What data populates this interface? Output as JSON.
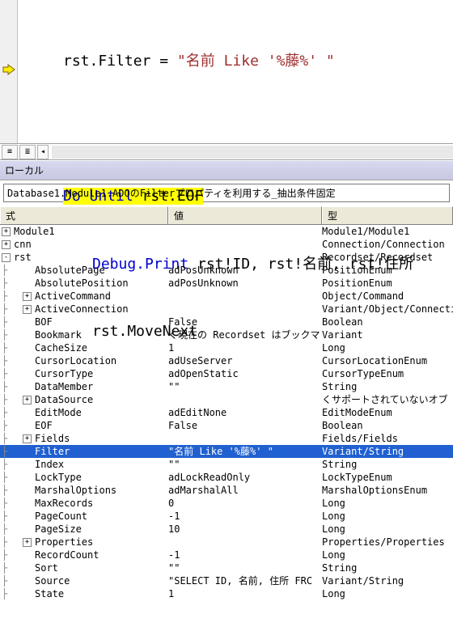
{
  "code": {
    "line1_a": "rst.Filter = ",
    "line1_b": "\"名前 Like '%藤%' \"",
    "line2_a": "Do Until",
    "line2_b": " rst.EOF",
    "line3_a": "Debug.Print",
    "line3_b": " rst!ID, rst!名前, rst!住所",
    "line4": "rst.MoveNext"
  },
  "panel_title": "ローカル",
  "context": "Database1.Module1.ADOのFilterプロパティを利用する_抽出条件固定",
  "columns": {
    "expr": "式",
    "value": "値",
    "type": "型"
  },
  "rows": [
    {
      "exp": "+",
      "depth": 0,
      "name": "Module1",
      "value": "",
      "type": "Module1/Module1"
    },
    {
      "exp": "+",
      "depth": 0,
      "name": "cnn",
      "value": "",
      "type": "Connection/Connection"
    },
    {
      "exp": "-",
      "depth": 0,
      "name": "rst",
      "value": "",
      "type": "Recordset/Recordset"
    },
    {
      "exp": "",
      "depth": 1,
      "name": "AbsolutePage",
      "value": "adPosUnknown",
      "type": "PositionEnum"
    },
    {
      "exp": "",
      "depth": 1,
      "name": "AbsolutePosition",
      "value": "adPosUnknown",
      "type": "PositionEnum"
    },
    {
      "exp": "+",
      "depth": 1,
      "name": "ActiveCommand",
      "value": "",
      "type": "Object/Command"
    },
    {
      "exp": "+",
      "depth": 1,
      "name": "ActiveConnection",
      "value": "",
      "type": "Variant/Object/Connection"
    },
    {
      "exp": "",
      "depth": 1,
      "name": "BOF",
      "value": "False",
      "type": "Boolean"
    },
    {
      "exp": "",
      "depth": 1,
      "name": "Bookmark",
      "value": "く現在の Recordset はブックマ",
      "type": "Variant"
    },
    {
      "exp": "",
      "depth": 1,
      "name": "CacheSize",
      "value": "1",
      "type": "Long"
    },
    {
      "exp": "",
      "depth": 1,
      "name": "CursorLocation",
      "value": "adUseServer",
      "type": "CursorLocationEnum"
    },
    {
      "exp": "",
      "depth": 1,
      "name": "CursorType",
      "value": "adOpenStatic",
      "type": "CursorTypeEnum"
    },
    {
      "exp": "",
      "depth": 1,
      "name": "DataMember",
      "value": "\"\"",
      "type": "String"
    },
    {
      "exp": "+",
      "depth": 1,
      "name": "DataSource",
      "value": "",
      "type": "くサポートされていないオブ"
    },
    {
      "exp": "",
      "depth": 1,
      "name": "EditMode",
      "value": "adEditNone",
      "type": "EditModeEnum"
    },
    {
      "exp": "",
      "depth": 1,
      "name": "EOF",
      "value": "False",
      "type": "Boolean"
    },
    {
      "exp": "+",
      "depth": 1,
      "name": "Fields",
      "value": "",
      "type": "Fields/Fields"
    },
    {
      "exp": "",
      "depth": 1,
      "name": "Filter",
      "value": "\"名前 Like '%藤%' \"",
      "type": "Variant/String",
      "selected": true
    },
    {
      "exp": "",
      "depth": 1,
      "name": "Index",
      "value": "\"\"",
      "type": "String"
    },
    {
      "exp": "",
      "depth": 1,
      "name": "LockType",
      "value": "adLockReadOnly",
      "type": "LockTypeEnum"
    },
    {
      "exp": "",
      "depth": 1,
      "name": "MarshalOptions",
      "value": "adMarshalAll",
      "type": "MarshalOptionsEnum"
    },
    {
      "exp": "",
      "depth": 1,
      "name": "MaxRecords",
      "value": "0",
      "type": "Long"
    },
    {
      "exp": "",
      "depth": 1,
      "name": "PageCount",
      "value": "-1",
      "type": "Long"
    },
    {
      "exp": "",
      "depth": 1,
      "name": "PageSize",
      "value": "10",
      "type": "Long"
    },
    {
      "exp": "+",
      "depth": 1,
      "name": "Properties",
      "value": "",
      "type": "Properties/Properties"
    },
    {
      "exp": "",
      "depth": 1,
      "name": "RecordCount",
      "value": "-1",
      "type": "Long"
    },
    {
      "exp": "",
      "depth": 1,
      "name": "Sort",
      "value": "\"\"",
      "type": "String"
    },
    {
      "exp": "",
      "depth": 1,
      "name": "Source",
      "value": "\"SELECT ID, 名前, 住所 FRC",
      "type": "Variant/String"
    },
    {
      "exp": "",
      "depth": 1,
      "name": "State",
      "value": "1",
      "type": "Long"
    }
  ]
}
